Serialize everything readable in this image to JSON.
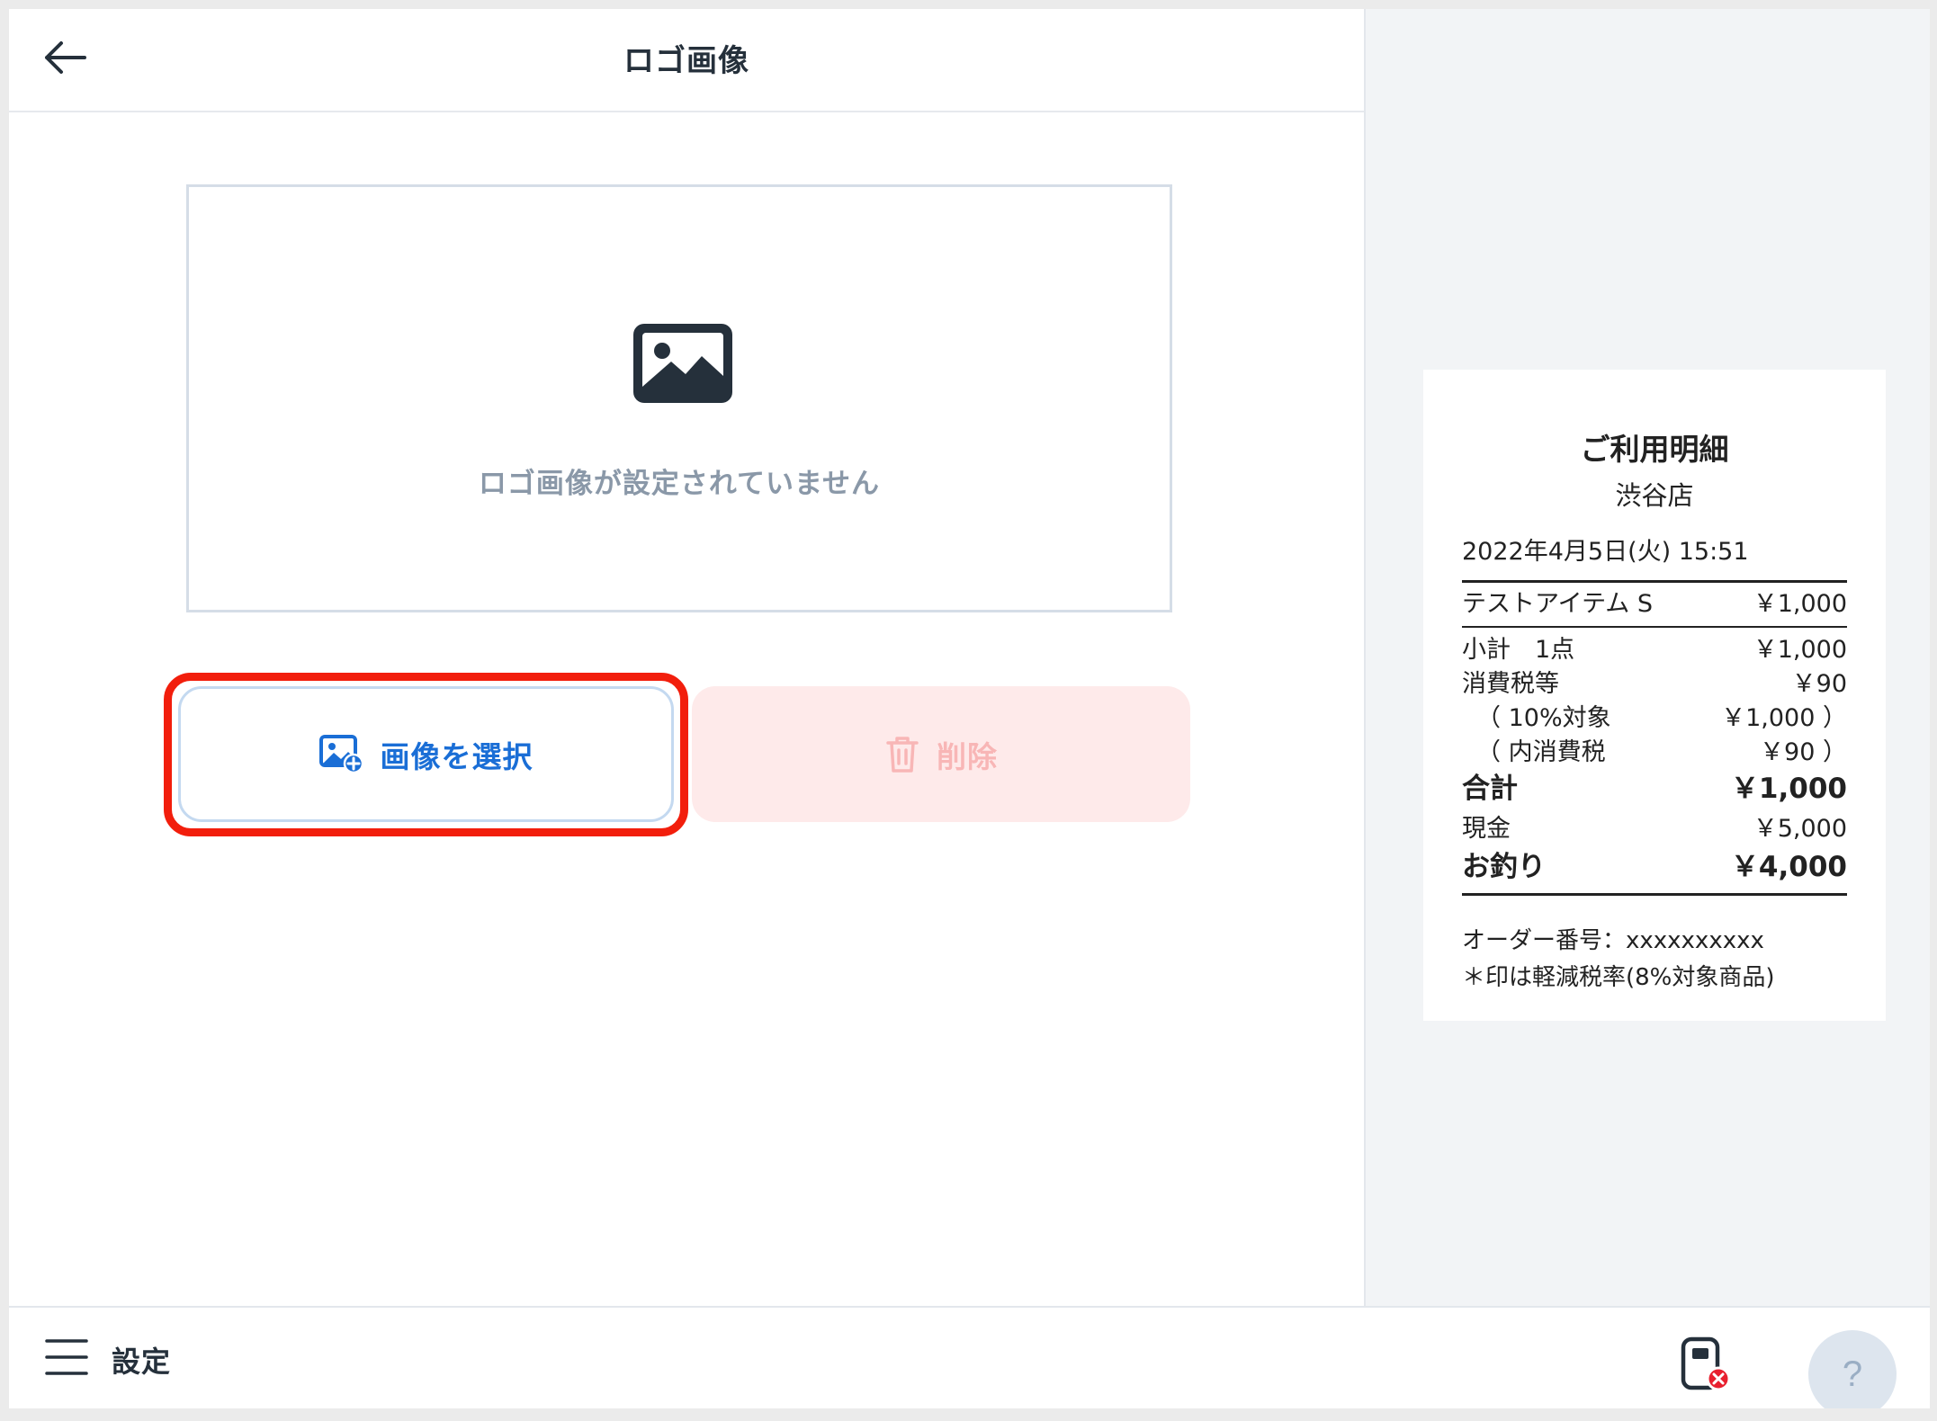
{
  "header": {
    "title": "ロゴ画像"
  },
  "logo_preview": {
    "empty_message": "ロゴ画像が設定されていません",
    "icon": "image-icon"
  },
  "actions": {
    "select_label": "画像を選択",
    "select_icon": "add-image-icon",
    "delete_label": "削除",
    "delete_icon": "trash-icon",
    "highlight_color": "#f21e0c"
  },
  "receipt": {
    "title": "ご利用明細",
    "store": "渋谷店",
    "datetime": "2022年4月5日(火) 15:51",
    "item": {
      "name": "テストアイテム S",
      "price": "￥1,000"
    },
    "subtotal": {
      "label": "小計　1点",
      "value": "￥1,000"
    },
    "tax": {
      "label": "消費税等",
      "value": "￥90"
    },
    "tax_target": {
      "label": "（ 10%対象",
      "value": "￥1,000 ）"
    },
    "tax_inner": {
      "label": "（ 内消費税",
      "value": "￥90 ）"
    },
    "total": {
      "label": "合計",
      "value": "￥1,000"
    },
    "cash": {
      "label": "現金",
      "value": "￥5,000"
    },
    "change": {
      "label": "お釣り",
      "value": "￥4,000"
    },
    "order_number": "オーダー番号：xxxxxxxxxx",
    "reduced_tax_note": "＊印は軽減税率(8%対象商品)"
  },
  "bottom_bar": {
    "menu_icon": "hamburger-menu-icon",
    "settings_label": "設定",
    "printer_icon": "printer-disconnected-icon",
    "help_label": "?"
  },
  "colors": {
    "accent": "#1a6ed6",
    "danger_disabled_bg": "#feeaea",
    "danger_disabled_text": "#f8b6b6"
  }
}
